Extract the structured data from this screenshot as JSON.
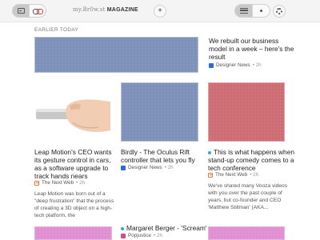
{
  "toolbar": {
    "logo_prefix": "my.Br0w.st",
    "logo_brand": "MAGAZINE",
    "add_label": "+"
  },
  "section": {
    "label": "EARLIER TODAY"
  },
  "articles": [
    {
      "title": "We rebuilt our business model in a week – here's the result",
      "source": "Designer News",
      "time": "2h",
      "source_icon": "designer-news-icon",
      "image": "blue"
    },
    {
      "title": "Leap Motion's CEO wants its gesture control in cars, as a software upgrade to track hands nears",
      "source": "The Next Web",
      "time": "2h",
      "source_icon": "the-next-web-icon",
      "image": "photo-hand-leap-motion",
      "excerpt": "Leap Motion was born out of a \"deep frustration\" that the process of creating a 3D object on a high-tech platform, the"
    },
    {
      "title": "Birdly - The Oculus Rift controller that lets you fly",
      "source": "Designer News",
      "time": "2h",
      "source_icon": "designer-news-icon",
      "image": "blue"
    },
    {
      "title": "This is what happens when stand-up comedy comes to a tech conference",
      "source": "The Next Web",
      "time": "2h",
      "unread": true,
      "source_icon": "the-next-web-icon",
      "image": "red",
      "excerpt": "We've shared many Vooza videos with you over the past couple of years, but co-founder and CEO 'Matthew Stillman' (AKA..."
    },
    {
      "title": "Margaret Berger - 'Scream'",
      "source": "Popjustice",
      "time": "2h",
      "unread": true,
      "source_icon": "popjustice-icon"
    }
  ],
  "colors": {
    "image_blue": "#7e92b9",
    "image_red": "#cc6e73",
    "image_pink": "#df8fd2",
    "unread_dot": "#37a4dd",
    "designer_news": "#2c6cd8"
  }
}
